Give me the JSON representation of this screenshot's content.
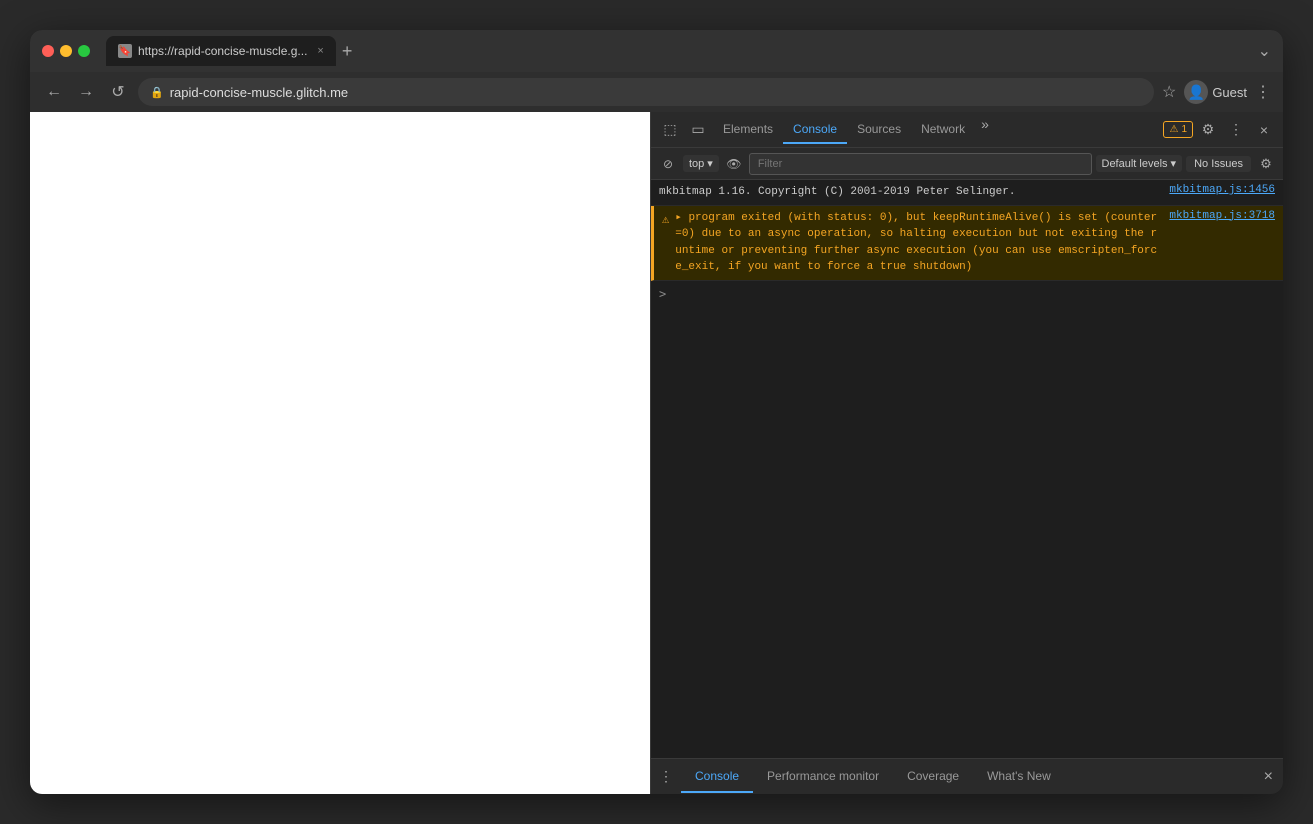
{
  "browser": {
    "tab_url": "https://rapid-concise-muscle.g...",
    "tab_close": "×",
    "new_tab": "+",
    "expand_icon": "⌄",
    "back": "←",
    "forward": "→",
    "reload": "↺",
    "address": "rapid-concise-muscle.glitch.me",
    "profile_expand": "⌄",
    "profile_label": "Guest"
  },
  "devtools": {
    "tabs": [
      {
        "label": "Elements",
        "active": false
      },
      {
        "label": "Console",
        "active": true
      },
      {
        "label": "Sources",
        "active": false
      },
      {
        "label": "Network",
        "active": false
      }
    ],
    "more_tabs": "»",
    "warning_count": "1",
    "settings_icon": "⚙",
    "more_options": "⋮",
    "close": "×",
    "inspect_icon": "⬚",
    "device_icon": "📱",
    "console_toolbar": {
      "clear_icon": "🚫",
      "context": "top",
      "context_arrow": "▾",
      "eye_icon": "👁",
      "filter_placeholder": "Filter",
      "levels_label": "Default levels",
      "levels_arrow": "▾",
      "no_issues": "No Issues",
      "settings_icon": "⚙"
    },
    "console_messages": [
      {
        "type": "info",
        "text": "mkbitmap 1.16. Copyright (C) 2001-2019 Peter Selinger.",
        "link": "mkbitmap.js:1456",
        "icon": ""
      },
      {
        "type": "warning",
        "text": "▸ program exited (with status: 0), but keepRuntimeAlive() is set (counter=0) due to an async operation, so halting execution but not exiting the runtime or preventing further async execution (you can use emscripten_force_exit, if you want to force a true shutdown)",
        "link": "mkbitmap.js:3718",
        "icon": "⚠"
      }
    ],
    "prompt_symbol": ">",
    "drawer": {
      "menu_icon": "⋮",
      "tabs": [
        {
          "label": "Console",
          "active": true
        },
        {
          "label": "Performance monitor",
          "active": false
        },
        {
          "label": "Coverage",
          "active": false
        },
        {
          "label": "What's New",
          "active": false
        }
      ],
      "close": "×"
    }
  }
}
